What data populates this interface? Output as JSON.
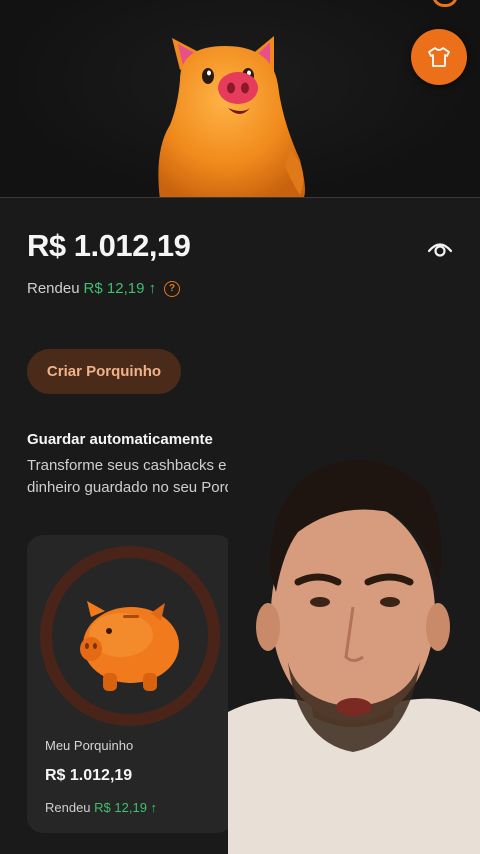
{
  "header": {
    "shirt_icon": "shirt-icon",
    "accent_color": "#ec6f1a"
  },
  "summary": {
    "balance": "R$ 1.012,19",
    "yield_label": "Rendeu",
    "yield_value": "R$ 12,19 ↑",
    "help_icon": "?"
  },
  "actions": {
    "create_label": "Criar Porquinho"
  },
  "auto_save": {
    "title": "Guardar automaticamente",
    "description": "Transforme seus cashbacks e rendimentos em dinheiro guardado no seu Porquinho"
  },
  "cards": [
    {
      "name": "Meu Porquinho",
      "balance": "R$ 1.012,19",
      "yield_label": "Rendeu",
      "yield_value": "R$ 12,19 ↑"
    }
  ],
  "colors": {
    "background": "#1a1a1a",
    "accent": "#ec6f1a",
    "positive": "#3fbf6f",
    "card": "#262626"
  }
}
